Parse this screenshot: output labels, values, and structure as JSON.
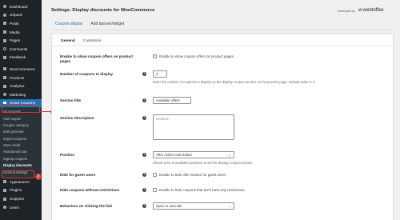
{
  "sidebar": {
    "top_items": [
      {
        "label": "Dashboard",
        "icon": "dashboard-icon"
      },
      {
        "label": "Jetpack",
        "icon": "jetpack-icon"
      },
      {
        "label": "Posts",
        "icon": "posts-icon"
      },
      {
        "label": "Media",
        "icon": "media-icon"
      },
      {
        "label": "Pages",
        "icon": "pages-icon"
      },
      {
        "label": "Comments",
        "icon": "comments-icon"
      },
      {
        "label": "Feedback",
        "icon": "feedback-icon"
      },
      {
        "label": "WooCommerce",
        "icon": "woocommerce-icon"
      },
      {
        "label": "Products",
        "icon": "products-icon"
      },
      {
        "label": "Analytics",
        "icon": "analytics-icon"
      },
      {
        "label": "Marketing",
        "icon": "marketing-icon"
      }
    ],
    "active_item": {
      "label": "Smart Coupons",
      "icon": "smart-coupons-icon"
    },
    "submenu": [
      "All coupons",
      "Add coupon",
      "Coupon category",
      "Bulk generate",
      "Import coupons",
      "Store credit",
      "Abandoned cart",
      "Signup coupons",
      "Display discounts",
      "General settings"
    ],
    "bottom_items": [
      {
        "label": "Appearance",
        "icon": "appearance-icon"
      },
      {
        "label": "Plugins",
        "icon": "plugins-icon"
      },
      {
        "label": "Snippets",
        "icon": "snippets-icon"
      },
      {
        "label": "Users",
        "icon": "users-icon"
      }
    ],
    "markers": [
      "1",
      "2"
    ]
  },
  "header": {
    "title": "Settings: Display discounts for WooCommerce",
    "developed_by": "Developed by",
    "brand_mark": "w",
    "brand_name": "webtoffee"
  },
  "tabs": [
    "Coupon display",
    "Add banner/widget"
  ],
  "subtabs": [
    "General",
    "Customize"
  ],
  "fields": {
    "show_offers": {
      "label": "Enable to show coupon offers on product pages",
      "checkbox_label": "Enable to show coupon offers on product pages",
      "checked": true
    },
    "num_coupons": {
      "label": "Number of coupons to display",
      "value": "3",
      "description": "Enter the number of coupons to display on the display coupon section on the product page. Default value is 3."
    },
    "section_title": {
      "label": "Section title",
      "value": "Available offers"
    },
    "section_description": {
      "label": "Section description",
      "placeholder": "Optional"
    },
    "position": {
      "label": "Position",
      "value": "After Add to cart button",
      "description": "Shows a list of available positions to set the display coupon section."
    },
    "hide_guest": {
      "label": "Hide for guest users",
      "checkbox_label": "Enable to hide offer section for guest users",
      "checked": false
    },
    "hide_without_restrictions": {
      "label": "Hide coupons without restrictions",
      "checkbox_label": "Enable to hide coupons that don't have any restrictions",
      "checked": false
    },
    "behaviour": {
      "label": "Behaviour on clicking the link",
      "value": "Open in new tab"
    }
  },
  "icons": {
    "help": "?",
    "chevron": "⌄",
    "check": "✓"
  },
  "colors": {
    "accent": "#2271b1",
    "highlight": "#d63638",
    "sidebar": "#1d2327"
  }
}
